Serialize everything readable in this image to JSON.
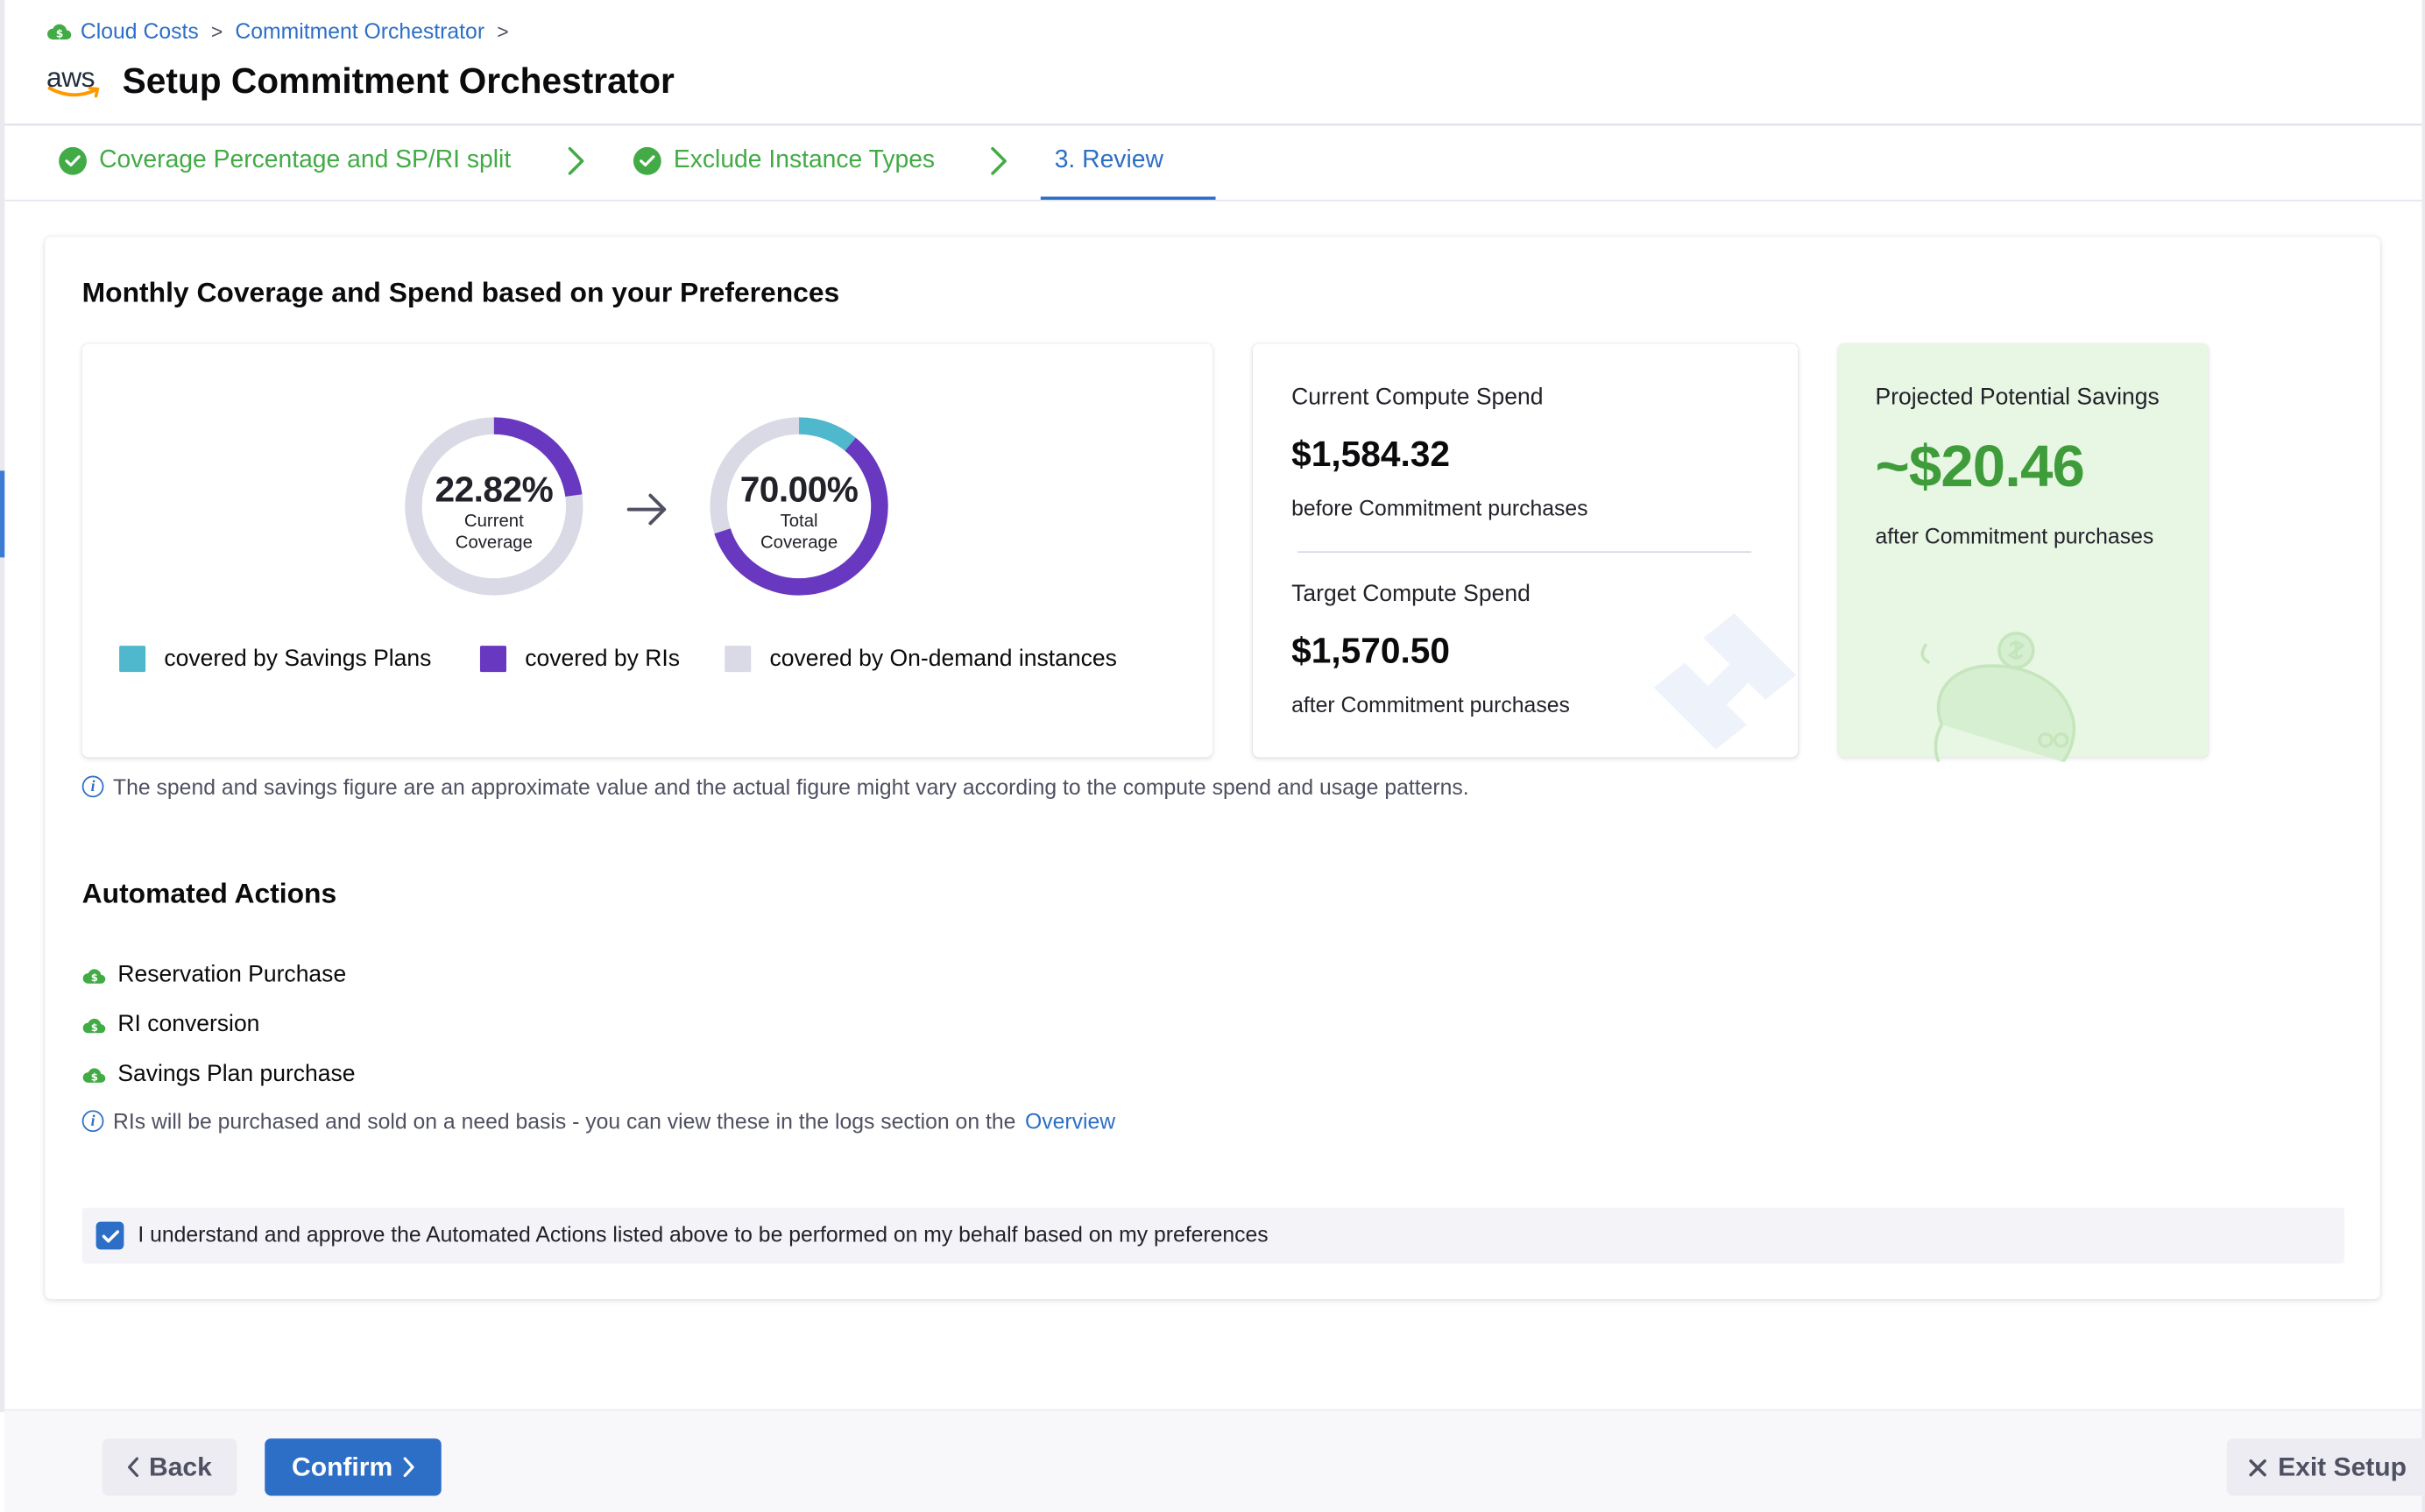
{
  "breadcrumb": {
    "items": [
      "Cloud Costs",
      "Commitment Orchestrator"
    ],
    "separator": ">"
  },
  "header": {
    "logo_text": "aws",
    "title": "Setup Commitment Orchestrator"
  },
  "stepper": {
    "steps": [
      {
        "label": "Coverage Percentage and SP/RI split",
        "status": "complete"
      },
      {
        "label": "Exclude Instance Types",
        "status": "complete"
      },
      {
        "label": "3. Review",
        "status": "active"
      }
    ]
  },
  "coverage_section": {
    "title": "Monthly Coverage and Spend based on your Preferences",
    "current": {
      "value": "22.82%",
      "label_line1": "Current",
      "label_line2": "Coverage",
      "fractions": {
        "savings_plans": 0.0,
        "ris": 0.2282,
        "on_demand": 0.7718
      }
    },
    "total": {
      "value": "70.00%",
      "label_line1": "Total",
      "label_line2": "Coverage",
      "fractions": {
        "savings_plans": 0.11,
        "ris": 0.59,
        "on_demand": 0.3
      }
    },
    "legend": [
      {
        "label": "covered by Savings Plans",
        "color": "#4fb8cc"
      },
      {
        "label": "covered by RIs",
        "color": "#6938c0"
      },
      {
        "label": "covered by On-demand instances",
        "color": "#d9dae5"
      }
    ]
  },
  "spend": {
    "current_label": "Current Compute Spend",
    "current_value": "$1,584.32",
    "current_sub": "before Commitment purchases",
    "target_label": "Target Compute Spend",
    "target_value": "$1,570.50",
    "target_sub": "after Commitment purchases"
  },
  "savings": {
    "label": "Projected Potential Savings",
    "value": "~$20.46",
    "sub": "after Commitment purchases"
  },
  "spend_note": "The spend and savings figure are an approximate value and the actual figure might vary according to the compute spend and usage patterns.",
  "automated_actions": {
    "title": "Automated Actions",
    "items": [
      "Reservation Purchase",
      "RI conversion",
      "Savings Plan purchase"
    ],
    "note_text": "RIs will be purchased and sold on a need basis - you can view these in the logs section on the",
    "note_link": "Overview"
  },
  "consent": {
    "checked": true,
    "text": "I understand and approve the Automated Actions listed above to be performed on my behalf based on my preferences"
  },
  "footer": {
    "back_label": "Back",
    "confirm_label": "Confirm",
    "exit_label": "Exit Setup"
  },
  "colors": {
    "accent": "#2d6fc6",
    "success": "#42ab45",
    "savings_green": "#3f9c3a",
    "savings_bg": "#e8f6e4",
    "ri_purple": "#6938c0",
    "sp_teal": "#4fb8cc",
    "ondemand_gray": "#d9dae5"
  },
  "icons": {
    "breadcrumb": "cloud-cost-icon",
    "step_complete": "check-circle-icon",
    "step_separator": "chevron-right-icon",
    "info": "info-icon",
    "action": "cloud-cost-icon",
    "back": "chevron-left-icon",
    "confirm": "chevron-right-icon",
    "exit": "close-icon"
  }
}
